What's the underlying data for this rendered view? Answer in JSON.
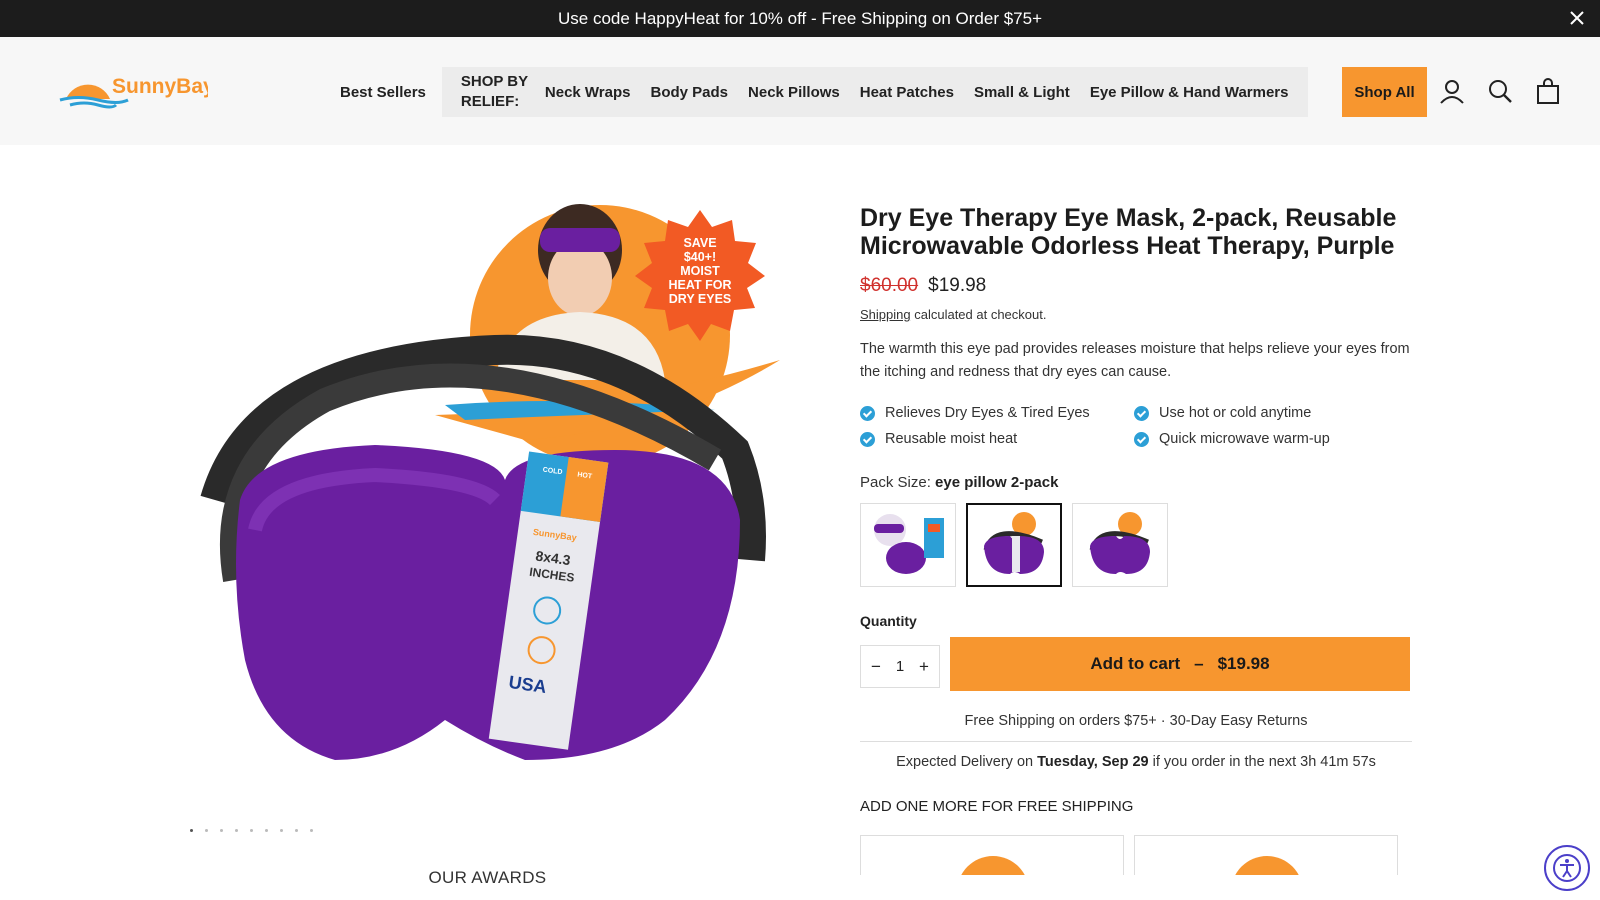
{
  "announcement": {
    "text": "Use code HappyHeat for 10% off - Free Shipping on Order $75+"
  },
  "header": {
    "logo_text": "SunnyBay",
    "nav_first": "Best Sellers",
    "relief_label": "SHOP BY RELIEF:",
    "relief_items": [
      "Neck Wraps",
      "Body Pads",
      "Neck Pillows",
      "Heat Patches",
      "Small & Light",
      "Eye Pillow & Hand Warmers"
    ],
    "shop_all": "Shop All",
    "icons": [
      "account-icon",
      "search-icon",
      "cart-icon"
    ]
  },
  "product": {
    "title": "Dry Eye Therapy Eye Mask, 2-pack, Reusable Microwavable Odorless Heat Therapy, Purple",
    "old_price": "$60.00",
    "price": "$19.98",
    "shipping_link": "Shipping",
    "shipping_text": " calculated at checkout.",
    "description": "The warmth this eye pad provides releases moisture that helps relieve your eyes from the itching and redness that dry eyes can cause.",
    "features": [
      "Relieves Dry Eyes & Tired Eyes",
      "Use hot or cold anytime",
      "Reusable moist heat",
      "Quick microwave warm-up"
    ],
    "pack_label": "Pack Size: ",
    "pack_value": "eye pillow 2-pack",
    "quantity_label": "Quantity",
    "quantity": "1",
    "add_to_cart": "Add to cart",
    "add_to_cart_sep": "–",
    "add_to_cart_price": "$19.98",
    "guarantee": "Free Shipping on orders $75+ · 30-Day Easy Returns",
    "delivery_prefix": "Expected Delivery on ",
    "delivery_date": "Tuesday, Sep 29",
    "delivery_suffix": " if you order in the next 3h 41m 57s",
    "upsell_title": "ADD ONE MORE FOR FREE SHIPPING",
    "badge_text": [
      "SAVE",
      "$40+!",
      "MOIST",
      "HEAT FOR",
      "DRY EYES"
    ],
    "label_text": [
      "COLD",
      "HOT",
      "SunnyBay",
      "8x4.3",
      "INCHES",
      "USA"
    ]
  },
  "gallery": {
    "slides": 9,
    "active": 0
  },
  "awards_title": "OUR AWARDS",
  "colors": {
    "accent": "#f7962f",
    "check": "#2c9fd6",
    "sale": "#d0312d",
    "mask": "#6a1fa0"
  }
}
